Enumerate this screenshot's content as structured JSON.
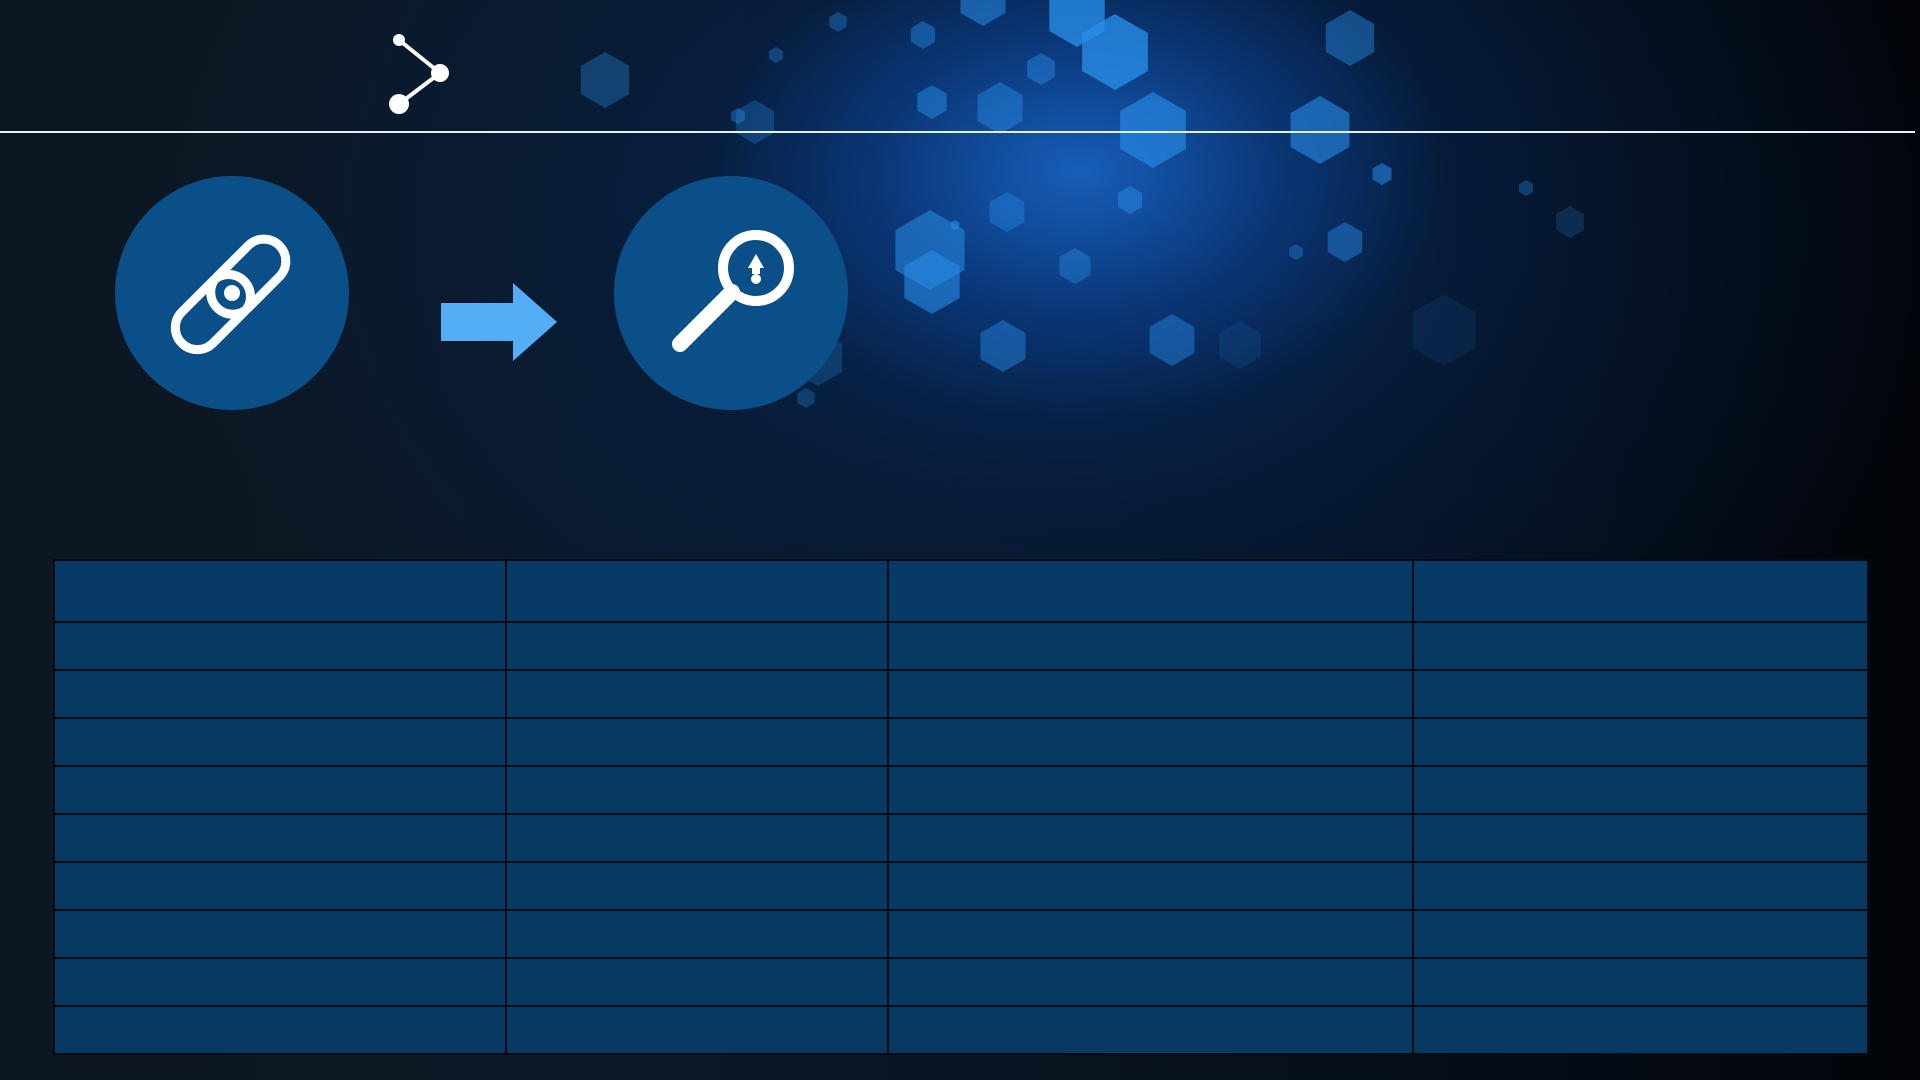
{
  "theme": {
    "accent": "#54aef5",
    "circle_fill": "#0b4f88",
    "table_fill": "#083963",
    "divider": "#e8eef6"
  },
  "header": {
    "icon": "share-icon"
  },
  "flow": {
    "steps": [
      {
        "icon": "chain-link-icon"
      },
      {
        "icon": "arrow-right-icon"
      },
      {
        "icon": "magnifier-icon"
      }
    ]
  },
  "table": {
    "columns": 4,
    "header": [
      "",
      "",
      "",
      ""
    ],
    "rows": [
      [
        "",
        "",
        "",
        ""
      ],
      [
        "",
        "",
        "",
        ""
      ],
      [
        "",
        "",
        "",
        ""
      ],
      [
        "",
        "",
        "",
        ""
      ],
      [
        "",
        "",
        "",
        ""
      ],
      [
        "",
        "",
        "",
        ""
      ],
      [
        "",
        "",
        "",
        ""
      ],
      [
        "",
        "",
        "",
        ""
      ],
      [
        "",
        "",
        "",
        ""
      ]
    ]
  }
}
